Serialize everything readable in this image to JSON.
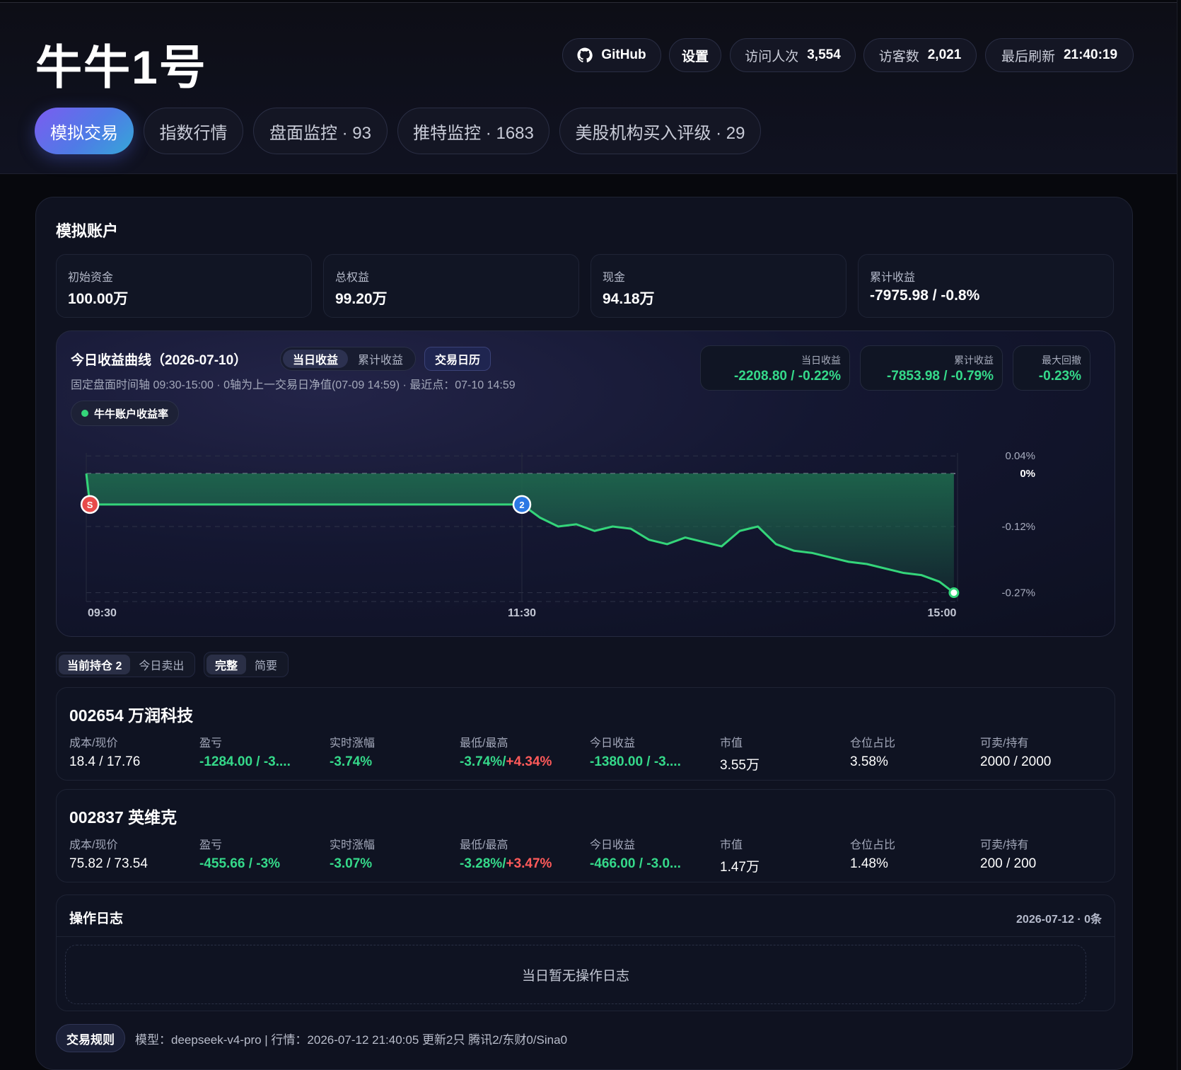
{
  "app": {
    "title": "牛牛1号"
  },
  "header": {
    "github_label": "GitHub",
    "settings_label": "设置",
    "visits_label": "访问人次",
    "visits_value": "3,554",
    "visitors_label": "访客数",
    "visitors_value": "2,021",
    "refresh_label": "最后刷新",
    "refresh_value": "21:40:19"
  },
  "tabs": [
    {
      "label": "模拟交易",
      "active": true
    },
    {
      "label": "指数行情"
    },
    {
      "label": "盘面监控 · 93"
    },
    {
      "label": "推特监控 · 1683"
    },
    {
      "label": "美股机构买入评级 · 29"
    }
  ],
  "account": {
    "title": "模拟账户",
    "stats": [
      {
        "label": "初始资金",
        "value": "100.00万"
      },
      {
        "label": "总权益",
        "value": "99.20万"
      },
      {
        "label": "现金",
        "value": "94.18万"
      },
      {
        "label": "累计收益",
        "value": "-7975.98 / -0.8%"
      }
    ]
  },
  "chart_card": {
    "title": "今日收益曲线（2026-07-10）",
    "mode_today": "当日收益",
    "mode_cumulative": "累计收益",
    "calendar_label": "交易日历",
    "subtitle": "固定盘面时间轴 09:30-15:00 · 0轴为上一交易日净值(07-09 14:59) · 最近点：07-10 14:59",
    "legend_label": "牛牛账户收益率",
    "kpis": [
      {
        "label": "当日收益",
        "value": "-2208.80 / -0.22%"
      },
      {
        "label": "累计收益",
        "value": "-7853.98 / -0.79%"
      },
      {
        "label": "最大回撤",
        "value": "-0.23%"
      }
    ],
    "markers": {
      "start": "S",
      "second": "2"
    }
  },
  "chart_data": {
    "type": "area",
    "series": [
      {
        "name": "牛牛账户收益率",
        "x": [
          "09:30",
          "09:31",
          "11:30",
          "13:00",
          "13:05",
          "13:10",
          "13:15",
          "13:20",
          "13:25",
          "13:30",
          "13:35",
          "13:40",
          "13:45",
          "13:50",
          "13:55",
          "14:00",
          "14:05",
          "14:10",
          "14:15",
          "14:20",
          "14:25",
          "14:30",
          "14:35",
          "14:40",
          "14:45",
          "14:50",
          "14:55",
          "14:59"
        ],
        "values": [
          0.0,
          -0.07,
          -0.07,
          -0.07,
          -0.1,
          -0.12,
          -0.115,
          -0.13,
          -0.12,
          -0.125,
          -0.15,
          -0.16,
          -0.145,
          -0.155,
          -0.165,
          -0.13,
          -0.12,
          -0.16,
          -0.175,
          -0.18,
          -0.19,
          -0.2,
          -0.205,
          -0.215,
          -0.225,
          -0.23,
          -0.245,
          -0.27
        ]
      }
    ],
    "xticks": [
      "09:30",
      "11:30",
      "15:00"
    ],
    "yticks": [
      "0.04%",
      "0%",
      "-0.12%",
      "-0.27%"
    ],
    "ylim": [
      -0.29,
      0.05
    ],
    "colors": {
      "line": "#34d57a",
      "fill": "#1e6e4f",
      "start_marker": "#e84a4a",
      "mid_marker": "#2b78e4"
    }
  },
  "positions": {
    "tab_holding": "当前持仓 2",
    "tab_sold": "今日卖出",
    "view_full": "完整",
    "view_brief": "简要",
    "headers": [
      "成本/现价",
      "盈亏",
      "实时涨幅",
      "最低/最高",
      "今日收益",
      "市值",
      "仓位占比",
      "可卖/持有"
    ],
    "items": [
      {
        "name": "002654 万润科技",
        "cost_price": "18.4 / 17.76",
        "pnl": "-1284.00 / -3....",
        "change": "-3.74%",
        "low": "-3.74%",
        "high": "+4.34%",
        "today": "-1380.00 / -3....",
        "mkt_value": "3.55万",
        "weight": "3.58%",
        "sell_hold": "2000 / 2000"
      },
      {
        "name": "002837 英维克",
        "cost_price": "75.82 / 73.54",
        "pnl": "-455.66 / -3%",
        "change": "-3.07%",
        "low": "-3.28%",
        "high": "+3.47%",
        "today": "-466.00 / -3.0...",
        "mkt_value": "1.47万",
        "weight": "1.48%",
        "sell_hold": "200 / 200"
      }
    ]
  },
  "log": {
    "title": "操作日志",
    "meta": "2026-07-12 · 0条",
    "empty": "当日暂无操作日志"
  },
  "footer": {
    "rules_label": "交易规则",
    "text": "模型：deepseek-v4-pro | 行情：2026-07-12 21:40:05 更新2只 腾讯2/东财0/Sina0"
  }
}
